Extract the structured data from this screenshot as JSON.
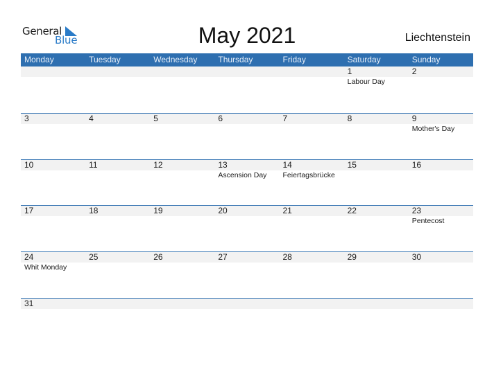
{
  "logo": {
    "line1": "General",
    "line2": "Blue",
    "accent_color": "#2a7bc8"
  },
  "title": "May 2021",
  "country": "Liechtenstein",
  "colors": {
    "header_bg": "#2e6fb0",
    "date_band": "#f2f2f2"
  },
  "weekdays": [
    "Monday",
    "Tuesday",
    "Wednesday",
    "Thursday",
    "Friday",
    "Saturday",
    "Sunday"
  ],
  "weeks": [
    [
      {
        "day": "",
        "holiday": ""
      },
      {
        "day": "",
        "holiday": ""
      },
      {
        "day": "",
        "holiday": ""
      },
      {
        "day": "",
        "holiday": ""
      },
      {
        "day": "",
        "holiday": ""
      },
      {
        "day": "1",
        "holiday": "Labour Day"
      },
      {
        "day": "2",
        "holiday": ""
      }
    ],
    [
      {
        "day": "3",
        "holiday": ""
      },
      {
        "day": "4",
        "holiday": ""
      },
      {
        "day": "5",
        "holiday": ""
      },
      {
        "day": "6",
        "holiday": ""
      },
      {
        "day": "7",
        "holiday": ""
      },
      {
        "day": "8",
        "holiday": ""
      },
      {
        "day": "9",
        "holiday": "Mother's Day"
      }
    ],
    [
      {
        "day": "10",
        "holiday": ""
      },
      {
        "day": "11",
        "holiday": ""
      },
      {
        "day": "12",
        "holiday": ""
      },
      {
        "day": "13",
        "holiday": "Ascension Day"
      },
      {
        "day": "14",
        "holiday": "Feiertagsbrücke"
      },
      {
        "day": "15",
        "holiday": ""
      },
      {
        "day": "16",
        "holiday": ""
      }
    ],
    [
      {
        "day": "17",
        "holiday": ""
      },
      {
        "day": "18",
        "holiday": ""
      },
      {
        "day": "19",
        "holiday": ""
      },
      {
        "day": "20",
        "holiday": ""
      },
      {
        "day": "21",
        "holiday": ""
      },
      {
        "day": "22",
        "holiday": ""
      },
      {
        "day": "23",
        "holiday": "Pentecost"
      }
    ],
    [
      {
        "day": "24",
        "holiday": "Whit Monday"
      },
      {
        "day": "25",
        "holiday": ""
      },
      {
        "day": "26",
        "holiday": ""
      },
      {
        "day": "27",
        "holiday": ""
      },
      {
        "day": "28",
        "holiday": ""
      },
      {
        "day": "29",
        "holiday": ""
      },
      {
        "day": "30",
        "holiday": ""
      }
    ],
    [
      {
        "day": "31",
        "holiday": ""
      },
      {
        "day": "",
        "holiday": ""
      },
      {
        "day": "",
        "holiday": ""
      },
      {
        "day": "",
        "holiday": ""
      },
      {
        "day": "",
        "holiday": ""
      },
      {
        "day": "",
        "holiday": ""
      },
      {
        "day": "",
        "holiday": ""
      }
    ]
  ]
}
